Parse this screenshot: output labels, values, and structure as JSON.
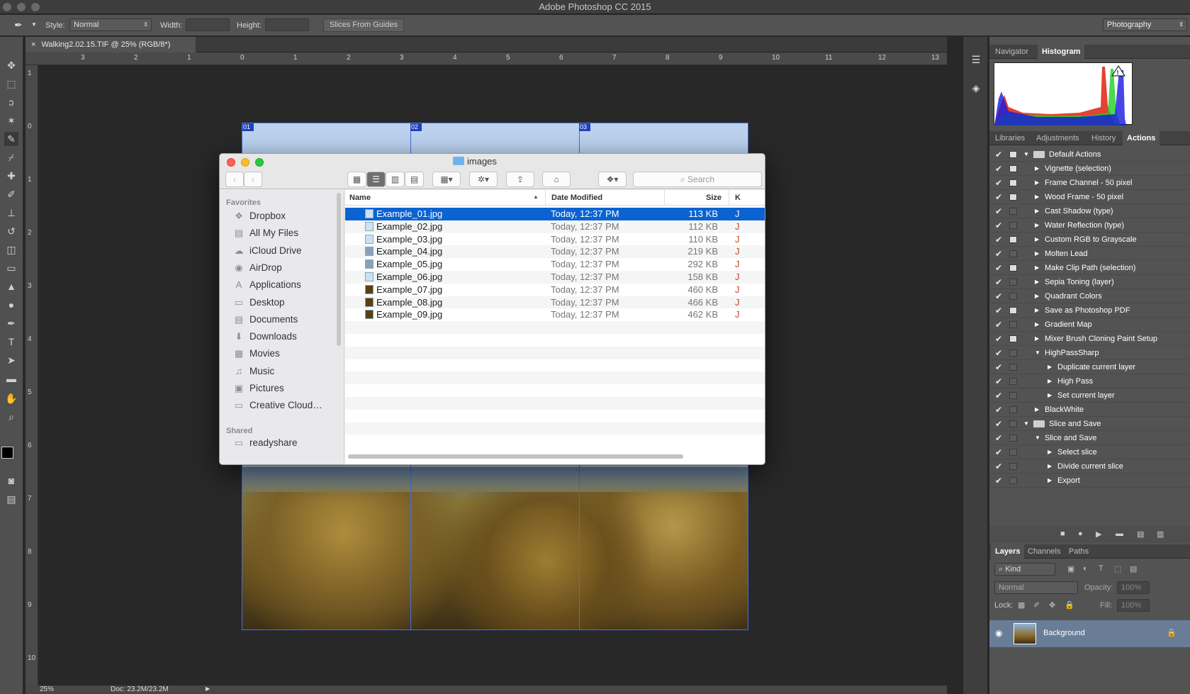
{
  "app": {
    "title": "Adobe Photoshop CC 2015"
  },
  "options_bar": {
    "style_label": "Style:",
    "style_value": "Normal",
    "width_label": "Width:",
    "height_label": "Height:",
    "slices_button": "Slices From Guides",
    "workspace": "Photography"
  },
  "document": {
    "tab_title": "Walking2.02.15.TIF @ 25% (RGB/8*)",
    "zoom": "25%",
    "doc_size": "Doc: 23.2M/23.2M",
    "slice_labels": [
      "01",
      "02",
      "03"
    ],
    "hruler": [
      "3",
      "2",
      "1",
      "0",
      "1",
      "2",
      "3",
      "4",
      "5",
      "6",
      "7",
      "8",
      "9",
      "10",
      "11",
      "12",
      "13"
    ],
    "vruler": [
      "1",
      "0",
      "1",
      "2",
      "3",
      "4",
      "5",
      "6",
      "7",
      "8",
      "9",
      "10"
    ]
  },
  "right_panel": {
    "tabs_top": [
      "Navigator",
      "Histogram"
    ],
    "tabs_mid": [
      "Libraries",
      "Adjustments",
      "History",
      "Actions"
    ],
    "actions": [
      {
        "label": "Default Actions",
        "level": 0,
        "folder": true,
        "open": true,
        "box": true
      },
      {
        "label": "Vignette (selection)",
        "level": 1,
        "box": true
      },
      {
        "label": "Frame Channel - 50 pixel",
        "level": 1,
        "box": true
      },
      {
        "label": "Wood Frame - 50 pixel",
        "level": 1,
        "box": true
      },
      {
        "label": "Cast Shadow (type)",
        "level": 1,
        "box": false
      },
      {
        "label": "Water Reflection (type)",
        "level": 1,
        "box": false
      },
      {
        "label": "Custom RGB to Grayscale",
        "level": 1,
        "box": true
      },
      {
        "label": "Molten Lead",
        "level": 1,
        "box": false
      },
      {
        "label": "Make Clip Path (selection)",
        "level": 1,
        "box": true
      },
      {
        "label": "Sepia Toning (layer)",
        "level": 1,
        "box": false
      },
      {
        "label": "Quadrant Colors",
        "level": 1,
        "box": false
      },
      {
        "label": "Save as Photoshop PDF",
        "level": 1,
        "box": true
      },
      {
        "label": "Gradient Map",
        "level": 1,
        "box": false
      },
      {
        "label": "Mixer Brush Cloning Paint Setup",
        "level": 1,
        "box": true
      },
      {
        "label": "HighPassSharp",
        "level": 1,
        "open": true,
        "box": false
      },
      {
        "label": "Duplicate current layer",
        "level": 2,
        "box": false
      },
      {
        "label": "High Pass",
        "level": 2,
        "box": false
      },
      {
        "label": "Set current layer",
        "level": 2,
        "box": false
      },
      {
        "label": "BlackWhite",
        "level": 1,
        "box": false
      },
      {
        "label": "Slice and Save",
        "level": 0,
        "folder": true,
        "open": true,
        "box": false
      },
      {
        "label": "Slice and Save",
        "level": 1,
        "open": true,
        "box": false
      },
      {
        "label": "Select slice",
        "level": 2,
        "box": false
      },
      {
        "label": "Divide current slice",
        "level": 2,
        "box": false
      },
      {
        "label": "Export",
        "level": 2,
        "box": false
      }
    ],
    "tabs_bottom": [
      "Layers",
      "Channels",
      "Paths"
    ],
    "layers": {
      "kind": "Kind",
      "blend": "Normal",
      "opacity_label": "Opacity:",
      "opacity": "100%",
      "lock_label": "Lock:",
      "fill_label": "Fill:",
      "fill": "100%",
      "layer_name": "Background"
    }
  },
  "finder": {
    "title": "images",
    "search_placeholder": "Search",
    "favorites_label": "Favorites",
    "favorites": [
      {
        "label": "Dropbox",
        "icon": "dropbox-icon",
        "glyph": "❖"
      },
      {
        "label": "All My Files",
        "icon": "all-files-icon",
        "glyph": "▤"
      },
      {
        "label": "iCloud Drive",
        "icon": "cloud-icon",
        "glyph": "☁"
      },
      {
        "label": "AirDrop",
        "icon": "airdrop-icon",
        "glyph": "◉"
      },
      {
        "label": "Applications",
        "icon": "applications-icon",
        "glyph": "A"
      },
      {
        "label": "Desktop",
        "icon": "desktop-icon",
        "glyph": "▭"
      },
      {
        "label": "Documents",
        "icon": "documents-icon",
        "glyph": "▤"
      },
      {
        "label": "Downloads",
        "icon": "downloads-icon",
        "glyph": "⬇"
      },
      {
        "label": "Movies",
        "icon": "movies-icon",
        "glyph": "▦"
      },
      {
        "label": "Music",
        "icon": "music-icon",
        "glyph": "♫"
      },
      {
        "label": "Pictures",
        "icon": "pictures-icon",
        "glyph": "▣"
      },
      {
        "label": "Creative Cloud…",
        "icon": "folder-icon",
        "glyph": "▭"
      }
    ],
    "shared_label": "Shared",
    "shared": [
      {
        "label": "readyshare",
        "icon": "server-icon",
        "glyph": "▭"
      }
    ],
    "columns": {
      "name": "Name",
      "date": "Date Modified",
      "size": "Size",
      "kind": "K"
    },
    "files": [
      {
        "name": "Example_01.jpg",
        "date": "Today, 12:37 PM",
        "size": "113 KB"
      },
      {
        "name": "Example_02.jpg",
        "date": "Today, 12:37 PM",
        "size": "112 KB"
      },
      {
        "name": "Example_03.jpg",
        "date": "Today, 12:37 PM",
        "size": "110 KB"
      },
      {
        "name": "Example_04.jpg",
        "date": "Today, 12:37 PM",
        "size": "219 KB"
      },
      {
        "name": "Example_05.jpg",
        "date": "Today, 12:37 PM",
        "size": "292 KB"
      },
      {
        "name": "Example_06.jpg",
        "date": "Today, 12:37 PM",
        "size": "158 KB"
      },
      {
        "name": "Example_07.jpg",
        "date": "Today, 12:37 PM",
        "size": "460 KB"
      },
      {
        "name": "Example_08.jpg",
        "date": "Today, 12:37 PM",
        "size": "466 KB"
      },
      {
        "name": "Example_09.jpg",
        "date": "Today, 12:37 PM",
        "size": "462 KB"
      }
    ],
    "selected_index": 0,
    "kind_letter": "J"
  },
  "colors": {
    "selection": "#0b63d1",
    "slice_fill": "#bcd3f0",
    "hist_red": "#e02010",
    "hist_green": "#20d020",
    "hist_blue": "#1818e0"
  }
}
